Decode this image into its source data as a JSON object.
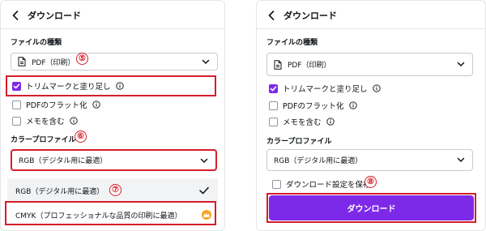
{
  "left": {
    "header": {
      "title": "ダウンロード"
    },
    "file_type": {
      "label": "ファイルの種類",
      "value": "PDF（印刷）",
      "annotation": "⑤"
    },
    "options": [
      {
        "label": "トリムマークと塗り足し",
        "checked": true
      },
      {
        "label": "PDFのフラット化",
        "checked": false
      },
      {
        "label": "メモを含む",
        "checked": false
      }
    ],
    "color_profile": {
      "label": "カラープロファイル",
      "value": "RGB（デジタル用に最適）",
      "annotation": "⑥"
    },
    "dropdown": {
      "items": [
        {
          "label": "RGB（デジタル用に最適）",
          "annotation": "⑦",
          "selected": true
        },
        {
          "label": "CMYK（プロフェッショナルな品質の印刷に最適）",
          "selected": false,
          "premium": true
        }
      ]
    }
  },
  "right": {
    "header": {
      "title": "ダウンロード"
    },
    "file_type": {
      "label": "ファイルの種類",
      "value": "PDF（印刷）"
    },
    "options": [
      {
        "label": "トリムマークと塗り足し",
        "checked": true
      },
      {
        "label": "PDFのフラット化",
        "checked": false
      },
      {
        "label": "メモを含む",
        "checked": false
      }
    ],
    "color_profile": {
      "label": "カラープロファイル",
      "value": "RGB（デジタル用に最適）"
    },
    "save_settings": {
      "label": "ダウンロード設定を保存",
      "checked": false,
      "annotation": "⑧"
    },
    "download_button": {
      "label": "ダウンロード"
    }
  },
  "colors": {
    "accent": "#7d2ae8",
    "annotation_red": "#d41e2a",
    "premium": "#f5a623"
  },
  "icons": [
    "chevron-left-icon",
    "document-icon",
    "chevron-down-icon",
    "info-icon",
    "checkmark-icon",
    "crown-icon"
  ]
}
